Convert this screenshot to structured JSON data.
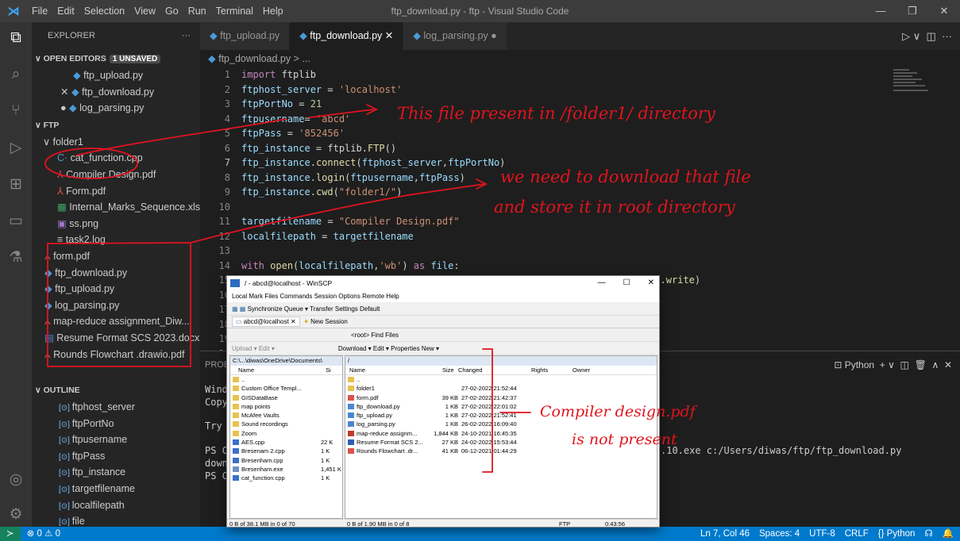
{
  "window": {
    "title": "ftp_download.py - ftp - Visual Studio Code",
    "menu": [
      "File",
      "Edit",
      "Selection",
      "View",
      "Go",
      "Run",
      "Terminal",
      "Help"
    ]
  },
  "explorer": {
    "header": "EXPLORER",
    "open_editors_label": "OPEN EDITORS",
    "unsaved_badge": "1 UNSAVED",
    "open_editors": [
      "ftp_upload.py",
      "ftp_download.py",
      "log_parsing.py"
    ],
    "ftp_label": "FTP",
    "folder": "folder1",
    "folder_files": [
      "cat_function.cpp",
      "Compiler Design.pdf",
      "Form.pdf",
      "Internal_Marks_Sequence.xlsx",
      "ss.png",
      "task2.log"
    ],
    "root_files": [
      "form.pdf",
      "ftp_download.py",
      "ftp_upload.py",
      "log_parsing.py",
      "map-reduce assignment_Diw...",
      "Resume Format SCS 2023.docx",
      "Rounds Flowchart .drawio.pdf"
    ],
    "outline_label": "OUTLINE",
    "outline": [
      "ftphost_server",
      "ftpPortNo",
      "ftpusername",
      "ftpPass",
      "ftp_instance",
      "targetfilename",
      "localfilepath",
      "file"
    ]
  },
  "tabs": [
    "ftp_upload.py",
    "ftp_download.py",
    "log_parsing.py"
  ],
  "breadcrumb": "ftp_download.py > ...",
  "code": {
    "line_numbers": [
      "1",
      "2",
      "3",
      "4",
      "5",
      "6",
      "7",
      "8",
      "9",
      "10",
      "11",
      "12",
      "13",
      "14",
      "15",
      "16",
      "17",
      "18",
      "19",
      "20",
      "21"
    ]
  },
  "panel": {
    "tab_label": "PROBL",
    "shell": "Python",
    "lines": [
      "Wind",
      "Copy",
      "Try",
      "PS C",
      "down",
      "PS C"
    ],
    "run_cmd": ".10.exe c:/Users/diwas/ftp/ftp_download.py"
  },
  "winscp": {
    "title": "/ - abcd@localhost - WinSCP",
    "menu": "Local  Mark  Files  Commands  Session  Options  Remote  Help",
    "toolbar1": "Synchronize    Queue ▾    Transfer Settings  Default",
    "session_tab": "abcd@localhost",
    "new_session": "New Session",
    "toolbar2": "<root>    Find Files",
    "toolbar3_left": "Upload ▾   Edit ▾",
    "toolbar3_right": "Download ▾   Edit ▾   Properties   New ▾",
    "left_path": "C:\\...\\diwas\\OneDrive\\Documents\\",
    "right_path": "/",
    "left_cols": [
      "Name",
      "Si"
    ],
    "right_cols": [
      "Name",
      "Size",
      "Changed",
      "Rights",
      "Owner"
    ],
    "left_files": [
      [
        "..",
        ""
      ],
      [
        "Custom Office Templ...",
        ""
      ],
      [
        "GISDataBase",
        ""
      ],
      [
        "map points",
        ""
      ],
      [
        "McAfee Vaults",
        ""
      ],
      [
        "Sound recordings",
        ""
      ],
      [
        "Zoom",
        ""
      ],
      [
        "AES.cpp",
        "22 K"
      ],
      [
        "Bresenam 2.cpp",
        "1 K"
      ],
      [
        "Bresenham.cpp",
        "1 K"
      ],
      [
        "Bresenham.exe",
        "1,451 K"
      ],
      [
        "cat_function.cpp",
        "1 K"
      ]
    ],
    "right_files": [
      [
        "..",
        "",
        ""
      ],
      [
        "folder1",
        "",
        "27-02-2022 21:52:44"
      ],
      [
        "form.pdf",
        "39 KB",
        "27-02-2022 21:42:37"
      ],
      [
        "ftp_download.py",
        "1 KB",
        "27-02-2022 22:01:02"
      ],
      [
        "ftp_upload.py",
        "1 KB",
        "27-02-2022 21:52:41"
      ],
      [
        "log_parsing.py",
        "1 KB",
        "26-02-2022 16:09:40"
      ],
      [
        "map-reduce assignm...",
        "1,844 KB",
        "24-10-2021 16:45:35"
      ],
      [
        "Resume Format SCS 2...",
        "27 KB",
        "24-02-2022 15:53:44"
      ],
      [
        "Rounds Flowchart .dr...",
        "41 KB",
        "06-12-2021 01:44:29"
      ]
    ],
    "left_status": "0 B of 38.1 MB in 0 of 70",
    "right_status": "0 B of 1.90 MB in 0 of 8",
    "protocol": "FTP",
    "time": "0:43:56"
  },
  "annotations": {
    "a1": "This file present in /folder1/ directory",
    "a2": "we need to download that file",
    "a3": "and store it in root directory",
    "a4": "Compiler design.pdf",
    "a5": "is not present"
  },
  "status": {
    "left": "⊗ 0 ⚠ 0",
    "position": "Ln 7, Col 46",
    "spaces": "Spaces: 4",
    "encoding": "UTF-8",
    "eol": "CRLF",
    "language": "{} Python"
  }
}
